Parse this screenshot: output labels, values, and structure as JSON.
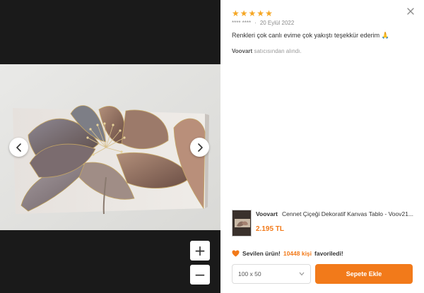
{
  "review": {
    "rating": 5,
    "stars": [
      "★",
      "★",
      "★",
      "★",
      "★"
    ],
    "star_color": "#f5a623",
    "author": "**** ****",
    "separator": "·",
    "date": "20 Eylül 2022",
    "comment": "Renkleri çok canlı evime çok yakıştı teşekkür ederim 🙏",
    "seller_name": "Voovart",
    "seller_suffix": "satıcısından alındı."
  },
  "viewer": {
    "prev_icon": "chevron-left-icon",
    "next_icon": "chevron-right-icon",
    "zoom_in_label": "+",
    "zoom_out_label": "−"
  },
  "product": {
    "brand": "Voovart",
    "title": "Cennet Çiçeği Dekoratif Kanvas Tablo - Voov21...",
    "price": "2.195 TL"
  },
  "favorite": {
    "icon": "heart-icon",
    "prefix": "Sevilen ürün!",
    "count": "10448 kişi",
    "suffix": "favoriledi!"
  },
  "size_select": {
    "value": "100 x 50",
    "icon": "chevron-down-icon"
  },
  "cart": {
    "label": "Sepete Ekle"
  },
  "colors": {
    "accent": "#f27a1a",
    "viewer_bg": "#1a1a1a"
  }
}
